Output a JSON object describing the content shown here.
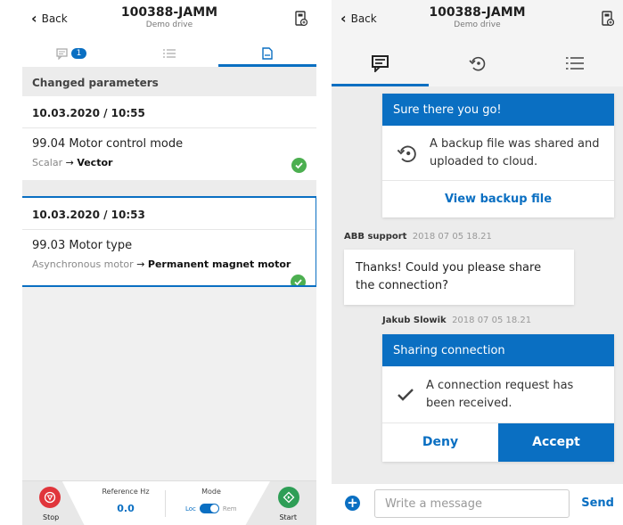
{
  "left": {
    "header": {
      "back_label": "Back",
      "title": "100388-JAMM",
      "subtitle": "Demo drive"
    },
    "tabs": [
      {
        "icon": "chat-icon",
        "badge": "1"
      },
      {
        "icon": "list-icon"
      },
      {
        "icon": "document-icon",
        "active": true
      }
    ],
    "section_title": "Changed parameters",
    "entries": [
      {
        "date": "10.03.2020 / 10:55",
        "param": "99.04 Motor control mode",
        "from": "Scalar",
        "to": "Vector"
      },
      {
        "date": "10.03.2020 / 10:53",
        "param": "99.03 Motor type",
        "from": "Asynchronous motor",
        "to": "Permanent magnet motor"
      }
    ],
    "controls": {
      "stop_label": "Stop",
      "reference_label": "Reference Hz",
      "reference_value": "0.0",
      "mode_label": "Mode",
      "mode_loc": "Loc",
      "mode_rem": "Rem",
      "start_label": "Start"
    }
  },
  "right": {
    "header": {
      "back_label": "Back",
      "title": "100388-JAMM",
      "subtitle": "Demo drive"
    },
    "tabs": [
      {
        "icon": "chat-icon",
        "active": true
      },
      {
        "icon": "backup-icon"
      },
      {
        "icon": "list-icon"
      }
    ],
    "backup_card": {
      "title": "Sure there you go!",
      "text": "A backup file was shared and uploaded to cloud.",
      "link": "View backup file"
    },
    "support_msg": {
      "sender": "ABB support",
      "time": "2018 07 05 18.21",
      "text": "Thanks! Could you please share the connection?"
    },
    "share_card": {
      "sender": "Jakub Slowik",
      "time": "2018 07 05 18.21",
      "title": "Sharing connection",
      "text": "A connection request has been received.",
      "deny": "Deny",
      "accept": "Accept"
    },
    "composer": {
      "placeholder": "Write a message",
      "send": "Send"
    }
  },
  "colors": {
    "accent": "#0a6fc2",
    "stop": "#e0353b",
    "start": "#2e9e56",
    "check": "#4caf50"
  }
}
